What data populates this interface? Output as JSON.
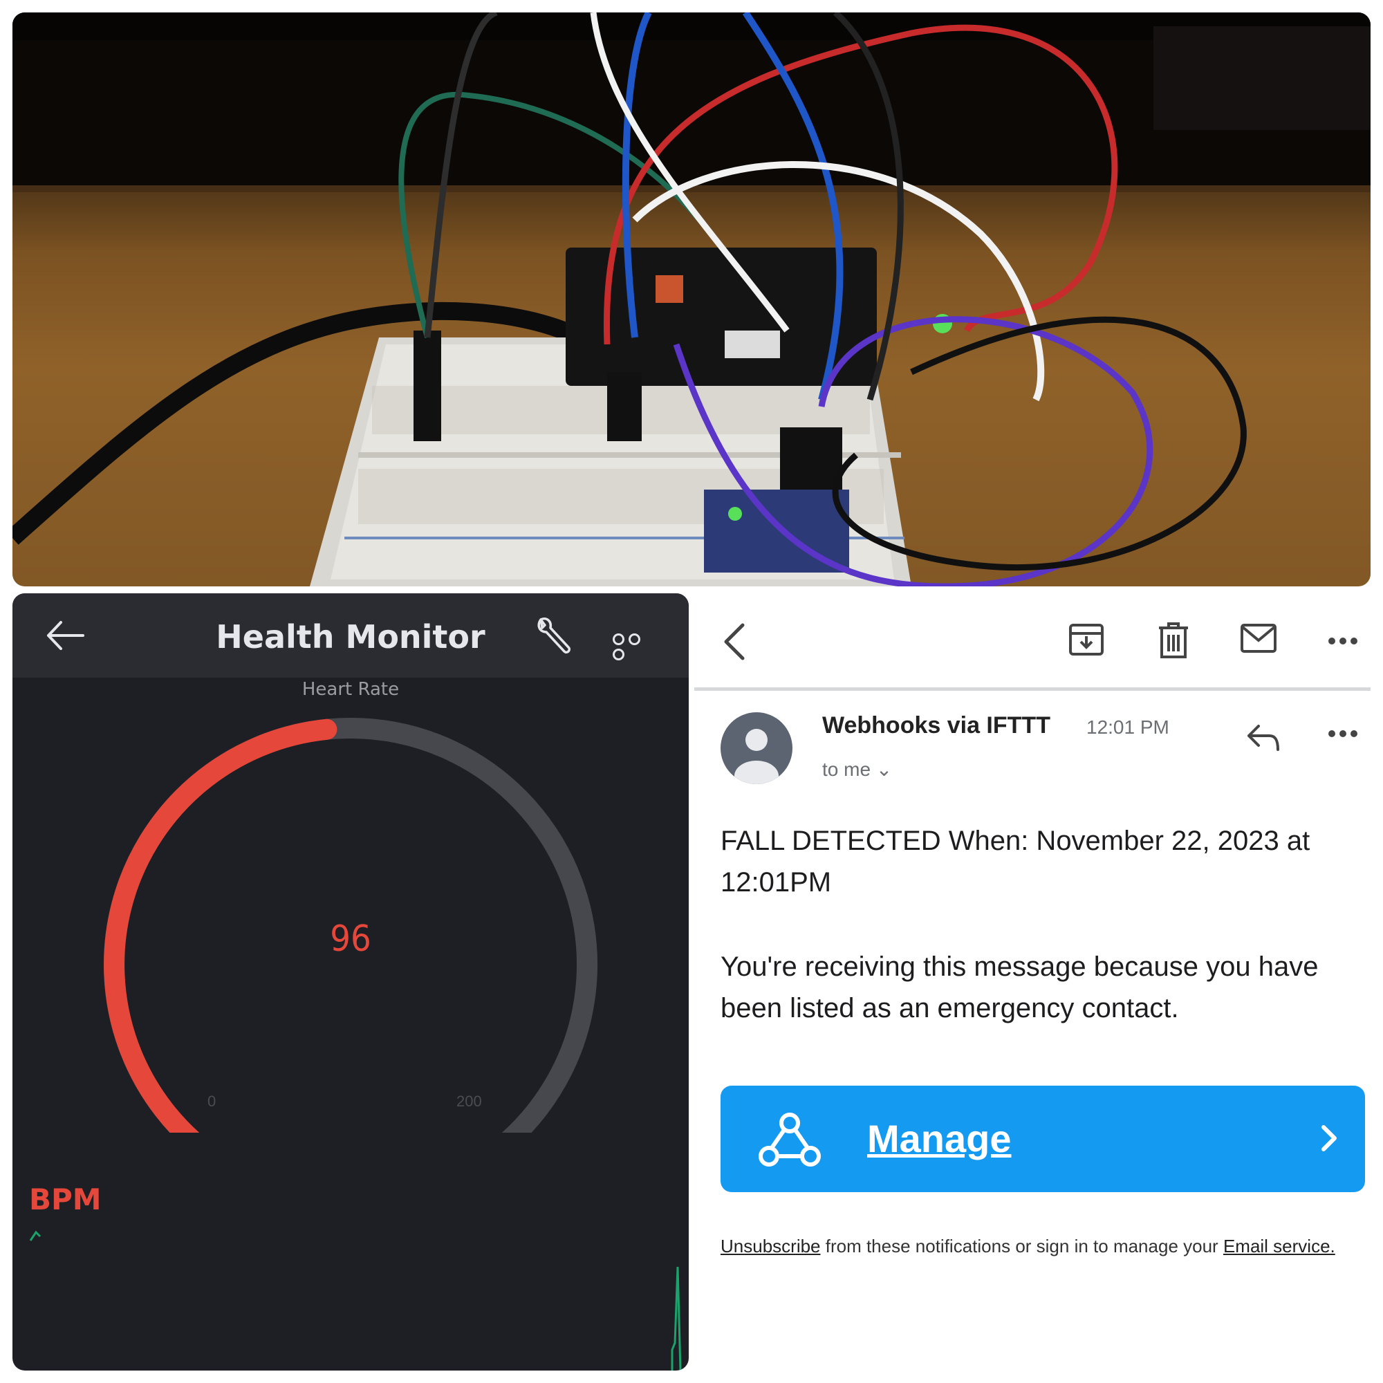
{
  "blynk": {
    "title": "Health Monitor",
    "gauge_label": "Heart Rate",
    "gauge_value": 96,
    "gauge_value_text": "96",
    "gauge_min": "0",
    "gauge_max": "200",
    "unit_label": "BPM",
    "colors": {
      "accent": "#e5473a",
      "track": "#47484d",
      "background": "#1e1f24",
      "header": "#2a2c31",
      "trace": "#1aa36a"
    },
    "icons": [
      "back-arrow-icon",
      "wrench-icon",
      "more-icon"
    ]
  },
  "email": {
    "toolbar_icons": [
      "back-chevron-icon",
      "archive-icon",
      "trash-icon",
      "mail-icon",
      "more-icon"
    ],
    "sender": "Webhooks via IFTTT",
    "time": "12:01 PM",
    "recipient": "to me ⌄",
    "body_line_1": "FALL DETECTED When: November 22, 2023 at 12:01PM",
    "body_line_2": "You're receiving this message because you have been listed as an emergency contact.",
    "button_label": "Manage",
    "footer": {
      "unsubscribe": "Unsubscribe",
      "middle": " from these notifications or sign in to manage your ",
      "email_service": "Email service."
    },
    "colors": {
      "button": "#149af0",
      "avatar": "#5b6470"
    }
  }
}
